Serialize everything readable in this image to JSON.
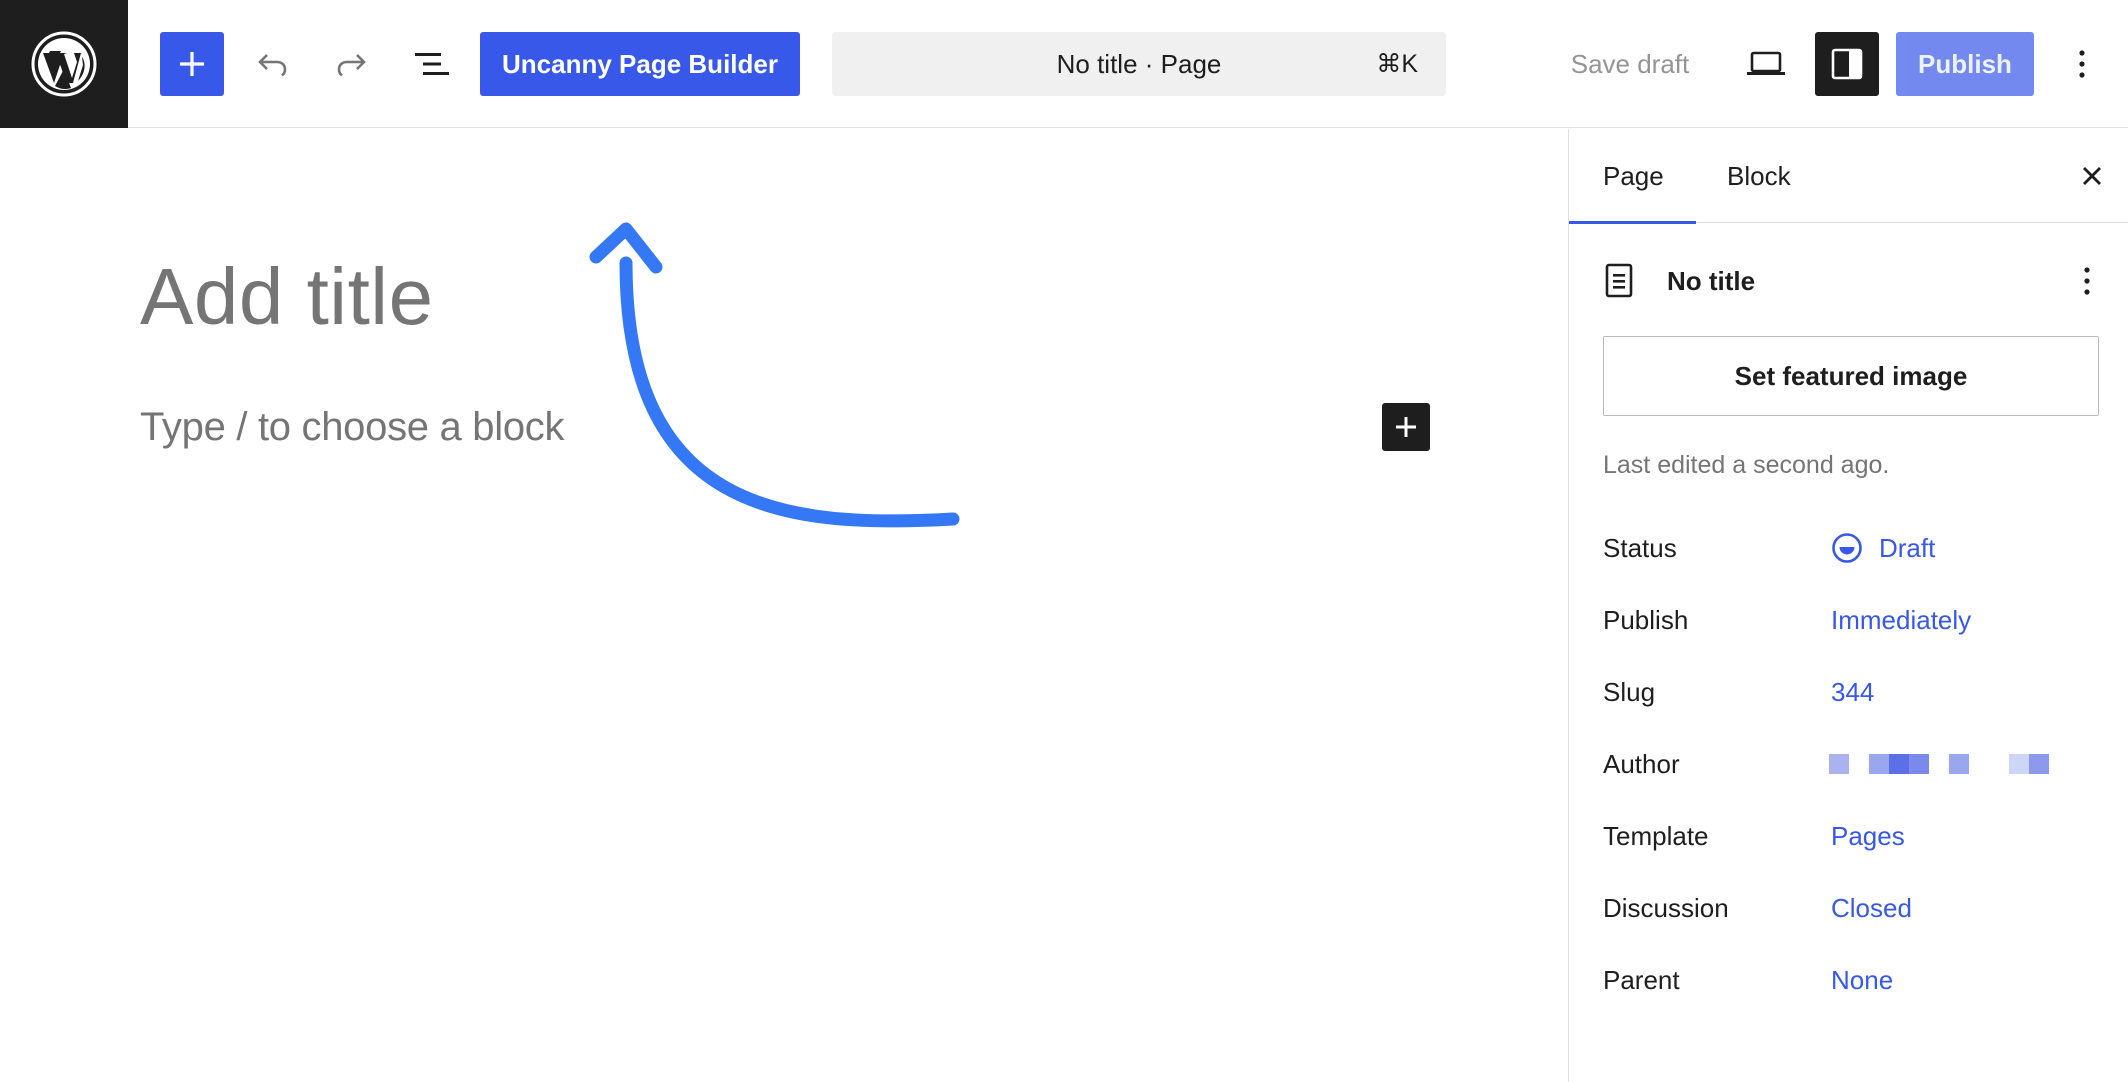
{
  "header": {
    "logo": "wordpress-logo",
    "inserter_icon": "plus-icon",
    "undo_icon": "undo-icon",
    "redo_icon": "redo-icon",
    "list_view_icon": "list-view-icon",
    "page_builder_label": "Uncanny Page Builder",
    "command_bar": {
      "title": "No title · Page",
      "shortcut": "⌘K"
    },
    "save_draft_label": "Save draft",
    "preview_icon": "laptop-icon",
    "settings_icon": "sidebar-toggle-icon",
    "publish_label": "Publish",
    "options_icon": "vertical-ellipsis-icon"
  },
  "editor": {
    "title_placeholder": "Add title",
    "block_placeholder": "Type / to choose a block",
    "block_add_icon": "plus-icon"
  },
  "sidebar": {
    "tabs": [
      {
        "label": "Page",
        "active": true
      },
      {
        "label": "Block",
        "active": false
      }
    ],
    "close_icon": "close-icon",
    "document": {
      "icon": "page-icon",
      "title": "No title",
      "menu_icon": "vertical-ellipsis-icon"
    },
    "featured_image_label": "Set featured image",
    "last_edited": "Last edited a second ago.",
    "meta": [
      {
        "label": "Status",
        "value": "Draft",
        "icon": "draft-status-icon"
      },
      {
        "label": "Publish",
        "value": "Immediately"
      },
      {
        "label": "Slug",
        "value": "344"
      },
      {
        "label": "Author",
        "value": ""
      },
      {
        "label": "Template",
        "value": "Pages"
      },
      {
        "label": "Discussion",
        "value": "Closed"
      },
      {
        "label": "Parent",
        "value": "None"
      }
    ]
  },
  "colors": {
    "accent": "#3858e9",
    "dark": "#1e1e1e",
    "annotation_arrow": "#3478f6"
  }
}
